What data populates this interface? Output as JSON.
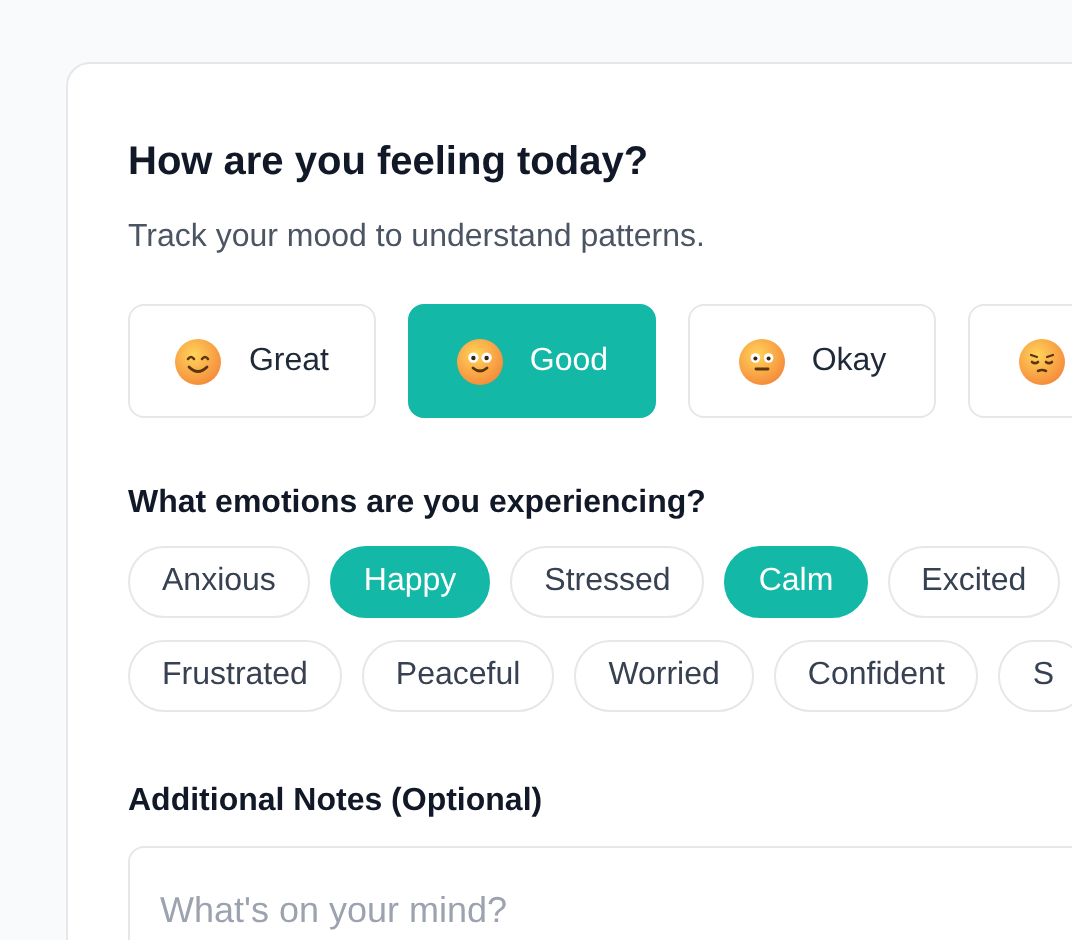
{
  "card": {
    "title": "How are you feeling today?",
    "subtitle": "Track your mood to understand patterns.",
    "moods": [
      {
        "kind": "smiling",
        "label": "Great",
        "selected": false
      },
      {
        "kind": "wide-eyed",
        "label": "Good",
        "selected": true
      },
      {
        "kind": "neutral",
        "label": "Okay",
        "selected": false
      },
      {
        "kind": "pensive",
        "selected": false
      }
    ],
    "emotions_heading": "What emotions are you experiencing?",
    "emotion_rows": [
      [
        {
          "label": "Anxious",
          "selected": false
        },
        {
          "label": "Happy",
          "selected": true
        },
        {
          "label": "Stressed",
          "selected": false
        },
        {
          "label": "Calm",
          "selected": true
        },
        {
          "label": "Excited",
          "selected": false
        }
      ],
      [
        {
          "label": "Frustrated",
          "selected": false
        },
        {
          "label": "Peaceful",
          "selected": false
        },
        {
          "label": "Worried",
          "selected": false
        },
        {
          "label": "Confident",
          "selected": false
        },
        {
          "label": "S",
          "selected": false
        }
      ]
    ],
    "notes_heading": "Additional Notes (Optional)",
    "notes": {
      "placeholder": "What's on your mind?"
    }
  }
}
